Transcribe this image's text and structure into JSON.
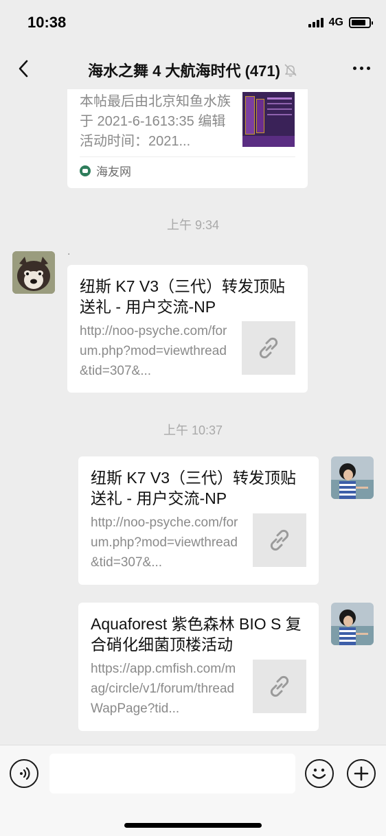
{
  "status_bar": {
    "time": "10:38",
    "network": "4G",
    "battery_level": 0.85
  },
  "header": {
    "title": "海水之舞 4 大航海时代 (471)",
    "muted": true,
    "icons": {
      "back": "chevron-left-icon",
      "mute": "bell-muted-icon",
      "more": "more-dots-icon"
    }
  },
  "messages": [
    {
      "type": "shared-article",
      "side": "left",
      "partial": true,
      "desc": "本帖最后由北京知鱼水族于 2021-6-1613:35 编辑活动时间：2021...",
      "source": "海友网",
      "thumbnail": "product-promo-image"
    },
    {
      "type": "timestamp",
      "text": "上午 9:34"
    },
    {
      "type": "shared-link",
      "side": "left",
      "sender_name": ".",
      "avatar": "dog-avatar",
      "title": "纽斯 K7 V3（三代）转发顶贴送礼 - 用户交流-NP",
      "desc": "http://noo-psyche.com/forum.php?mod=viewthread&tid=307&...",
      "thumb_icon": "link-icon"
    },
    {
      "type": "timestamp",
      "text": "上午 10:37"
    },
    {
      "type": "shared-link",
      "side": "right",
      "avatar": "child-photo-avatar",
      "title": "纽斯 K7 V3（三代）转发顶贴送礼 - 用户交流-NP",
      "desc": "http://noo-psyche.com/forum.php?mod=viewthread&tid=307&...",
      "thumb_icon": "link-icon"
    },
    {
      "type": "shared-link",
      "side": "right",
      "avatar": "child-photo-avatar",
      "title": "Aquaforest 紫色森林 BIO S 复合硝化细菌顶楼活动",
      "desc": "https://app.cmfish.com/mag/circle/v1/forum/threadWapPage?tid...",
      "thumb_icon": "link-icon"
    }
  ],
  "input_bar": {
    "value": "",
    "icons": [
      "voice-icon",
      "emoji-icon",
      "plus-icon"
    ]
  }
}
